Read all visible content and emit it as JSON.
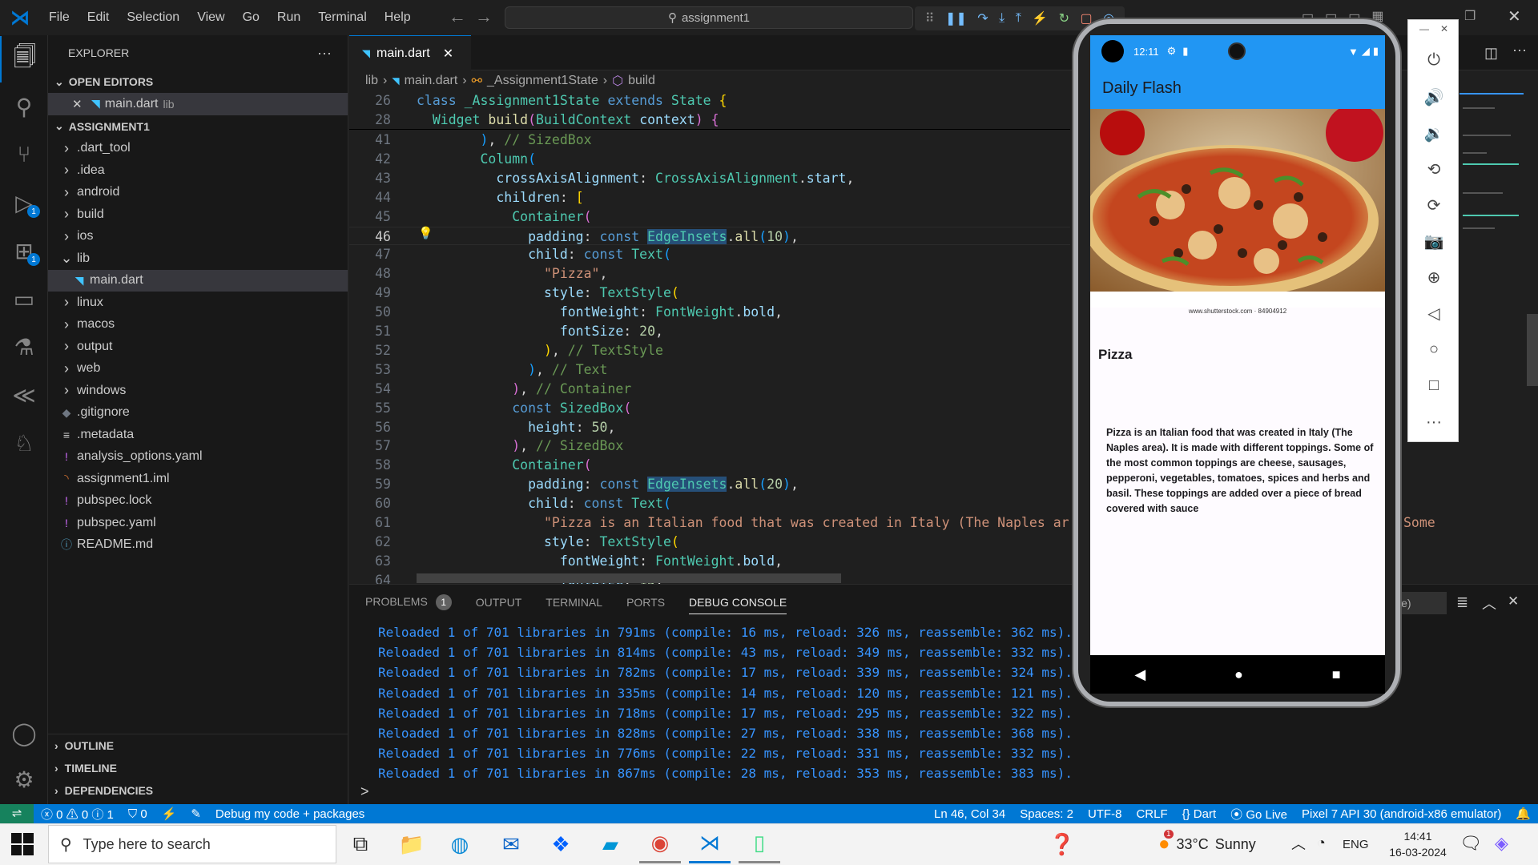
{
  "menu": [
    "File",
    "Edit",
    "Selection",
    "View",
    "Go",
    "Run",
    "Terminal",
    "Help"
  ],
  "command_center": "assignment1",
  "explorer": {
    "title": "EXPLORER",
    "open_editors_header": "OPEN EDITORS",
    "open_editor_file": "main.dart",
    "open_editor_folder": "lib",
    "project_header": "ASSIGNMENT1",
    "items": [
      {
        "label": ".dart_tool",
        "icon": "chevron-right",
        "indent": 1
      },
      {
        "label": ".idea",
        "icon": "chevron-right",
        "indent": 1
      },
      {
        "label": "android",
        "icon": "chevron-right",
        "indent": 1
      },
      {
        "label": "build",
        "icon": "chevron-right",
        "indent": 1
      },
      {
        "label": "ios",
        "icon": "chevron-right",
        "indent": 1
      },
      {
        "label": "lib",
        "icon": "chevron-down",
        "indent": 1
      },
      {
        "label": "main.dart",
        "icon": "dart",
        "indent": 2
      },
      {
        "label": "linux",
        "icon": "chevron-right",
        "indent": 1
      },
      {
        "label": "macos",
        "icon": "chevron-right",
        "indent": 1
      },
      {
        "label": "output",
        "icon": "chevron-right",
        "indent": 1
      },
      {
        "label": "web",
        "icon": "chevron-right",
        "indent": 1
      },
      {
        "label": "windows",
        "icon": "chevron-right",
        "indent": 1
      },
      {
        "label": ".gitignore",
        "icon": "git",
        "indent": 1
      },
      {
        "label": ".metadata",
        "icon": "lines",
        "indent": 1
      },
      {
        "label": "analysis_options.yaml",
        "icon": "exclaim",
        "indent": 1
      },
      {
        "label": "assignment1.iml",
        "icon": "rss",
        "indent": 1
      },
      {
        "label": "pubspec.lock",
        "icon": "exclaim",
        "indent": 1
      },
      {
        "label": "pubspec.yaml",
        "icon": "exclaim",
        "indent": 1
      },
      {
        "label": "README.md",
        "icon": "info",
        "indent": 1
      }
    ],
    "outline": "OUTLINE",
    "timeline": "TIMELINE",
    "dependencies": "DEPENDENCIES"
  },
  "tab": {
    "label": "main.dart"
  },
  "breadcrumb": [
    "lib",
    "main.dart",
    "_Assignment1State",
    "build"
  ],
  "code": {
    "sticky1_num": "26",
    "sticky2_num": "28",
    "line_numbers": [
      "41",
      "42",
      "43",
      "44",
      "45",
      "46",
      "47",
      "48",
      "49",
      "50",
      "51",
      "52",
      "53",
      "54",
      "55",
      "56",
      "57",
      "58",
      "59",
      "60",
      "61",
      "62",
      "63",
      "64"
    ],
    "current_line": "46"
  },
  "panel": {
    "tabs": [
      "PROBLEMS",
      "OUTPUT",
      "TERMINAL",
      "PORTS",
      "DEBUG CONSOLE"
    ],
    "problems_count": "1",
    "active_tab": "DEBUG CONSOLE",
    "filter_fragment": "le)",
    "console_lines": [
      "Reloaded 1 of 701 libraries in 791ms (compile: 16 ms, reload: 326 ms, reassemble: 362 ms).",
      "Reloaded 1 of 701 libraries in 814ms (compile: 43 ms, reload: 349 ms, reassemble: 332 ms).",
      "Reloaded 1 of 701 libraries in 782ms (compile: 17 ms, reload: 339 ms, reassemble: 324 ms).",
      "Reloaded 1 of 701 libraries in 335ms (compile: 14 ms, reload: 120 ms, reassemble: 121 ms).",
      "Reloaded 1 of 701 libraries in 718ms (compile: 17 ms, reload: 295 ms, reassemble: 322 ms).",
      "Reloaded 1 of 701 libraries in 828ms (compile: 27 ms, reload: 338 ms, reassemble: 368 ms).",
      "Reloaded 1 of 701 libraries in 776ms (compile: 22 ms, reload: 331 ms, reassemble: 332 ms).",
      "Reloaded 1 of 701 libraries in 867ms (compile: 28 ms, reload: 353 ms, reassemble: 383 ms)."
    ],
    "prompt": ">"
  },
  "statusbar": {
    "errors": "0",
    "warnings": "0",
    "infos": "1",
    "ports": "0",
    "debug_scope": "Debug my code + packages",
    "cursor": "Ln 46, Col 34",
    "spaces": "Spaces: 2",
    "encoding": "UTF-8",
    "eol": "CRLF",
    "language": "Dart",
    "golive": "Go Live",
    "device": "Pixel 7 API 30 (android-x86 emulator)"
  },
  "phone": {
    "time": "12:11",
    "app_title": "Daily Flash",
    "image_caption": "www.shutterstock.com · 84904912",
    "heading": "Pizza",
    "body": "Pizza is an Italian food that was created in Italy (The Naples area). It is made with different toppings. Some of the most common toppings are cheese, sausages, pepperoni, vegetables, tomatoes, spices and herbs and basil. These toppings are added over a piece of bread covered with sauce"
  },
  "taskbar": {
    "search_placeholder": "Type here to search",
    "temperature": "33°C",
    "weather": "Sunny",
    "language": "ENG",
    "time": "14:41",
    "date": "16-03-2024",
    "weather_badge": "1"
  },
  "colors": {
    "accent": "#0078d4",
    "appbar": "#2196f3",
    "console": "#3794ff"
  }
}
